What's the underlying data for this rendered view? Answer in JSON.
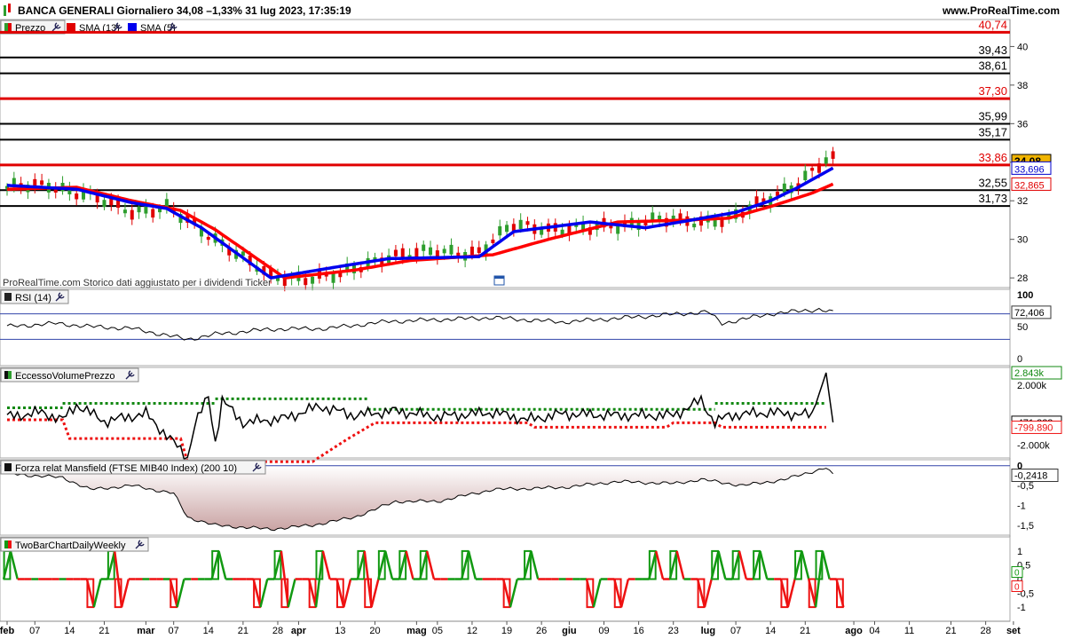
{
  "header": {
    "title": "BANCA GENERALI Giornaliero 34,08 –1,33% 31 lug 2023, 17:35:19",
    "site": "www.ProRealTime.com"
  },
  "colors": {
    "up": "#2e9e2e",
    "down": "#e00000",
    "sma13": "#ff0000",
    "sma5": "#0000ee",
    "level_black": "#000000",
    "level_red": "#e00000",
    "mansfield_fill": "#c9a3a3",
    "rsi_line": "#000000",
    "twobar_up": "#119911",
    "twobar_down": "#ee1111"
  },
  "chart_data": [
    {
      "type": "line",
      "panel": "price",
      "legend": [
        "Prezzo",
        "SMA (13)",
        "SMA (5)"
      ],
      "watermark": "ProRealTime.com  Storico dati aggiustato per i dividendi  Ticker",
      "ylim": [
        27.5,
        41.4
      ],
      "yticks": [
        "40",
        "38",
        "36",
        "34",
        "32",
        "30",
        "28"
      ],
      "horizontal_levels": [
        {
          "label": "40,74",
          "value": 40.74,
          "color": "red"
        },
        {
          "label": "39,43",
          "value": 39.43,
          "color": "black"
        },
        {
          "label": "38,61",
          "value": 38.61,
          "color": "black"
        },
        {
          "label": "37,30",
          "value": 37.3,
          "color": "red"
        },
        {
          "label": "35,99",
          "value": 35.99,
          "color": "black"
        },
        {
          "label": "35,17",
          "value": 35.17,
          "color": "black"
        },
        {
          "label": "33,86",
          "value": 33.86,
          "color": "red"
        },
        {
          "label": "32,55",
          "value": 32.55,
          "color": "black"
        },
        {
          "label": "31,73",
          "value": 31.73,
          "color": "black"
        }
      ],
      "current_labels": [
        {
          "label": "34,08",
          "value": 34.08
        },
        {
          "label": "33,696",
          "value": 33.696
        },
        {
          "label": "32,865",
          "value": 32.865
        }
      ],
      "x_anchor_days": [
        0,
        6,
        10,
        18,
        23,
        32,
        38,
        48,
        55,
        68,
        73,
        84,
        92,
        99,
        105,
        109,
        114,
        118
      ],
      "x_anchor_prices": [
        32.6,
        32.9,
        32.4,
        31.5,
        31.6,
        29.6,
        28.0,
        28.1,
        29.2,
        29.4,
        30.7,
        30.5,
        31.0,
        30.9,
        31.2,
        31.9,
        33.0,
        34.1
      ],
      "sma5_anchor_days": [
        0,
        10,
        18,
        23,
        28,
        38,
        48,
        55,
        68,
        73,
        84,
        92,
        97,
        105,
        110,
        114,
        119
      ],
      "sma5_anchor_values": [
        32.8,
        32.6,
        31.9,
        31.6,
        30.6,
        28.0,
        28.6,
        29.0,
        29.1,
        30.4,
        30.9,
        30.6,
        30.9,
        31.4,
        32.0,
        32.7,
        33.7
      ],
      "sma13_anchor_days": [
        0,
        10,
        18,
        25,
        30,
        40,
        50,
        58,
        70,
        78,
        88,
        98,
        104,
        110,
        116,
        119
      ],
      "sma13_anchor_values": [
        32.6,
        32.7,
        32.0,
        31.5,
        30.5,
        28.0,
        28.4,
        28.9,
        29.2,
        30.0,
        30.9,
        31.0,
        31.1,
        31.7,
        32.4,
        32.865
      ]
    },
    {
      "type": "line",
      "panel": "rsi",
      "title": "RSI (14)",
      "ylim": [
        0,
        100
      ],
      "yticks": [
        "100",
        "50",
        "0"
      ],
      "current_label": "72,406",
      "current_value": 72.406,
      "levels": [
        70,
        30
      ],
      "anchor_days": [
        0,
        7,
        12,
        18,
        26,
        30,
        38,
        46,
        55,
        70,
        80,
        101,
        103,
        110,
        117,
        119
      ],
      "anchor_values": [
        50,
        55,
        50,
        47,
        30,
        38,
        46,
        47,
        58,
        64,
        57,
        73,
        55,
        70,
        77,
        72
      ]
    },
    {
      "type": "line",
      "panel": "volume_excess",
      "title": "EccessoVolumePrezzo",
      "ylim": [
        -2850000,
        3200000
      ],
      "ytick_labels": [
        "2.000k",
        "-2.000k"
      ],
      "ytick_values": [
        2000000,
        -2000000
      ],
      "current_labels": [
        {
          "label": "2.843k",
          "value": 2843000
        },
        {
          "label": "-471.323",
          "value": -471323
        },
        {
          "label": "-799.890",
          "value": -799890
        }
      ],
      "upper_band_segments": [
        {
          "from": 0,
          "to": 8,
          "value": 500000
        },
        {
          "from": 8,
          "to": 30,
          "value": 800000
        },
        {
          "from": 30,
          "to": 52,
          "value": 1100000
        },
        {
          "from": 52,
          "to": 102,
          "value": 400000
        },
        {
          "from": 102,
          "to": 118,
          "value": 800000
        }
      ],
      "lower_band_anchor_days": [
        0,
        8,
        9,
        25,
        26,
        44,
        49,
        53,
        54,
        75,
        76,
        95,
        96,
        102,
        103,
        118
      ],
      "lower_band_anchor_values": [
        -300000,
        -300000,
        -1550000,
        -1550000,
        -3100000,
        -3100000,
        -1600000,
        -500000,
        -500000,
        -500000,
        -800000,
        -800000,
        -500000,
        -500000,
        -800000,
        -800000
      ],
      "line_anchor_days": [
        0,
        5,
        8,
        10,
        14,
        20,
        26,
        27,
        29,
        30,
        31,
        34,
        40,
        45,
        50,
        56,
        62,
        70,
        75,
        80,
        88,
        96,
        100,
        102,
        104,
        110,
        116,
        118,
        119
      ],
      "line_anchor_values": [
        -100000,
        200000,
        -300000,
        700000,
        -400000,
        100000,
        -2800000,
        -700000,
        1300000,
        -1800000,
        1000000,
        -500000,
        -200000,
        600000,
        0,
        300000,
        -100000,
        200000,
        -300000,
        100000,
        0,
        0,
        1000000,
        -500000,
        0,
        200000,
        0,
        2843000,
        -471323
      ]
    },
    {
      "type": "area",
      "panel": "mansfield",
      "title": "Forza relat Mansfield (FTSE MIB40 Index) (200 10)",
      "ylim": [
        -1.75,
        0.15
      ],
      "yticks": [
        "0",
        "-0,5",
        "-1",
        "-1,5"
      ],
      "current_label": "-0,2418",
      "current_value": -0.2418,
      "anchor_days": [
        0,
        8,
        12,
        18,
        24,
        26,
        30,
        38,
        44,
        50,
        56,
        62,
        70,
        80,
        88,
        96,
        100,
        106,
        112,
        116,
        118,
        119
      ],
      "anchor_values": [
        -0.2,
        -0.3,
        -0.6,
        -0.5,
        -0.7,
        -1.3,
        -1.5,
        -1.6,
        -1.5,
        -1.3,
        -0.9,
        -0.9,
        -0.6,
        -0.55,
        -0.4,
        -0.45,
        -0.35,
        -0.5,
        -0.35,
        -0.15,
        -0.05,
        -0.24
      ]
    },
    {
      "type": "line",
      "panel": "twobar",
      "title": "TwoBarChartDailyWeekly",
      "ylim": [
        -1.25,
        1.25
      ],
      "yticks": [
        "1",
        "0,5",
        "0",
        "-0,5",
        "-1"
      ],
      "current_labels": [
        {
          "label": "0",
          "value": 0,
          "color": "green"
        },
        {
          "label": "0",
          "value": 0,
          "color": "red"
        }
      ],
      "states": "GGRRGRRRGRRRRGGGRRRRGRRGRGGRGGGGGRRRRGGGRGRRRGRRRRGGRRGGGGRGGRRRGGGGGRRRRGGGGRRRGRGGRGGRRRRGGGRRGRGRRRGGGGRRGGGRRRGGRGGRR"
    },
    {
      "type": "axis",
      "panel": "time",
      "x_labels": [
        {
          "label": "feb",
          "day": 0,
          "bold": true
        },
        {
          "label": "07",
          "day": 4
        },
        {
          "label": "14",
          "day": 9
        },
        {
          "label": "21",
          "day": 14
        },
        {
          "label": "mar",
          "day": 20,
          "bold": true
        },
        {
          "label": "07",
          "day": 24
        },
        {
          "label": "14",
          "day": 29
        },
        {
          "label": "21",
          "day": 34
        },
        {
          "label": "28",
          "day": 39
        },
        {
          "label": "apr",
          "day": 42,
          "bold": true
        },
        {
          "label": "13",
          "day": 48
        },
        {
          "label": "20",
          "day": 53
        },
        {
          "label": "mag",
          "day": 59,
          "bold": true
        },
        {
          "label": "05",
          "day": 62
        },
        {
          "label": "12",
          "day": 67
        },
        {
          "label": "19",
          "day": 72
        },
        {
          "label": "26",
          "day": 77
        },
        {
          "label": "giu",
          "day": 81,
          "bold": true
        },
        {
          "label": "09",
          "day": 86
        },
        {
          "label": "16",
          "day": 91
        },
        {
          "label": "23",
          "day": 96
        },
        {
          "label": "lug",
          "day": 101,
          "bold": true
        },
        {
          "label": "07",
          "day": 105
        },
        {
          "label": "14",
          "day": 110
        },
        {
          "label": "21",
          "day": 115
        },
        {
          "label": "ago",
          "day": 122,
          "bold": true
        },
        {
          "label": "04",
          "day": 125
        },
        {
          "label": "11",
          "day": 130
        },
        {
          "label": "21",
          "day": 136
        },
        {
          "label": "28",
          "day": 141
        },
        {
          "label": "set",
          "day": 145,
          "bold": true
        }
      ]
    }
  ]
}
